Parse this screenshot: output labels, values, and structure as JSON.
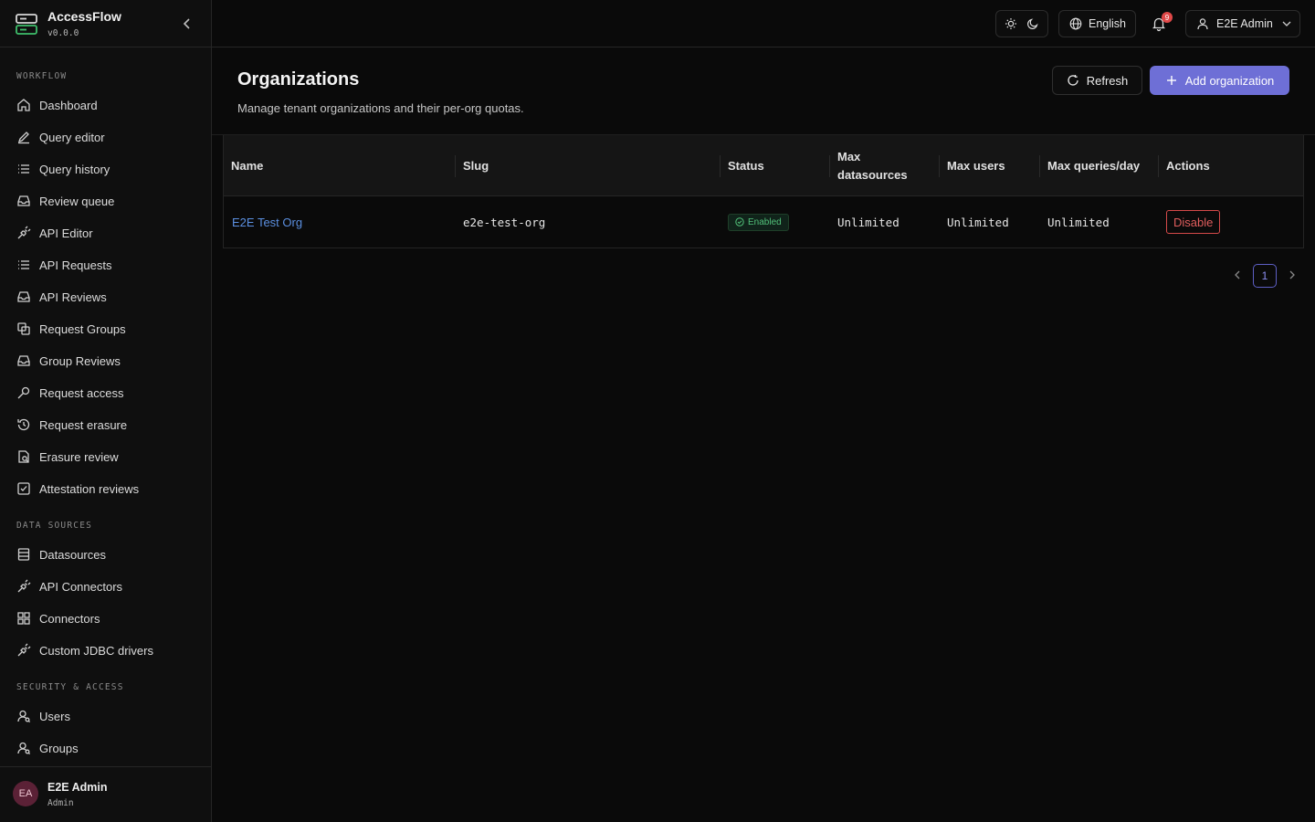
{
  "app": {
    "name": "AccessFlow",
    "version": "v0.0.0"
  },
  "sidebar": {
    "sections": [
      {
        "title": "WORKFLOW"
      },
      {
        "title": "DATA SOURCES"
      },
      {
        "title": "SECURITY & ACCESS"
      }
    ],
    "workflow_items": [
      {
        "label": "Dashboard",
        "icon": "home-icon"
      },
      {
        "label": "Query editor",
        "icon": "pencil-icon"
      },
      {
        "label": "Query history",
        "icon": "list-icon"
      },
      {
        "label": "Review queue",
        "icon": "inbox-icon"
      },
      {
        "label": "API Editor",
        "icon": "plug-icon"
      },
      {
        "label": "API Requests",
        "icon": "list-icon"
      },
      {
        "label": "API Reviews",
        "icon": "inbox-icon"
      },
      {
        "label": "Request Groups",
        "icon": "copy-icon"
      },
      {
        "label": "Group Reviews",
        "icon": "inbox-icon"
      },
      {
        "label": "Request access",
        "icon": "key-icon"
      },
      {
        "label": "Request erasure",
        "icon": "history-icon"
      },
      {
        "label": "Erasure review",
        "icon": "file-check-icon"
      },
      {
        "label": "Attestation reviews",
        "icon": "checkbox-icon"
      }
    ],
    "datasource_items": [
      {
        "label": "Datasources",
        "icon": "database-icon"
      },
      {
        "label": "API Connectors",
        "icon": "plug-icon"
      },
      {
        "label": "Connectors",
        "icon": "grid-icon"
      },
      {
        "label": "Custom JDBC drivers",
        "icon": "plug-icon"
      }
    ],
    "security_items": [
      {
        "label": "Users",
        "icon": "user-search-icon"
      },
      {
        "label": "Groups",
        "icon": "user-search-icon"
      }
    ],
    "footer_user": {
      "initials": "EA",
      "name": "E2E Admin",
      "role": "Admin"
    }
  },
  "topbar": {
    "language": "English",
    "notification_count": "9",
    "user": "E2E Admin"
  },
  "page": {
    "title": "Organizations",
    "subtitle": "Manage tenant organizations and their per-org quotas.",
    "refresh_label": "Refresh",
    "add_label": "Add organization"
  },
  "table": {
    "columns": [
      "Name",
      "Slug",
      "Status",
      "Max datasources",
      "Max users",
      "Max queries/day",
      "Actions"
    ],
    "column_lines": {
      "max_ds_1": "Max",
      "max_ds_2": "datasources"
    },
    "rows": [
      {
        "name": "E2E Test Org",
        "slug": "e2e-test-org",
        "status": "Enabled",
        "max_datasources": "Unlimited",
        "max_users": "Unlimited",
        "max_queries": "Unlimited",
        "action": "Disable"
      }
    ]
  },
  "pagination": {
    "current_page": "1"
  },
  "colors": {
    "accent": "#6e6fd6",
    "link": "#5b8fe0",
    "success": "#52c27a",
    "danger": "#e05d5d",
    "background": "#0a0a0a"
  }
}
